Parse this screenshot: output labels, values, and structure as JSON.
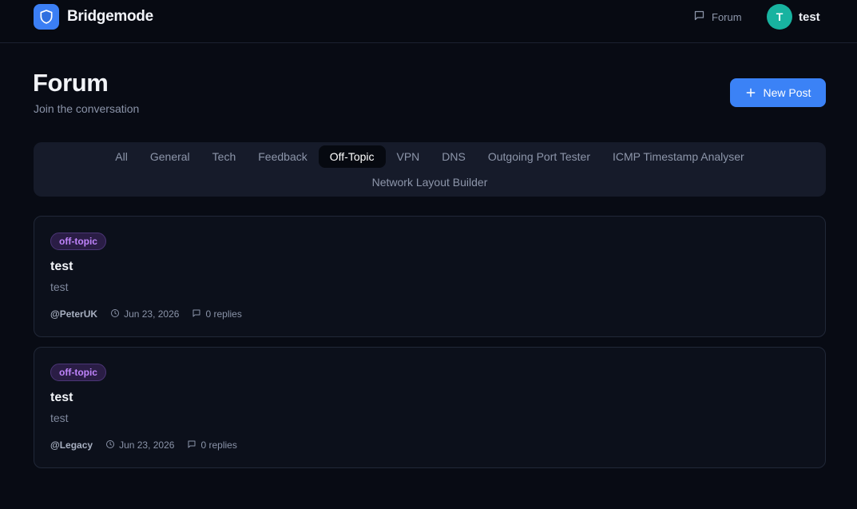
{
  "header": {
    "brand_name": "Bridgemode",
    "logo_icon": "shield-icon",
    "nav_forum_label": "Forum",
    "user_initial": "T",
    "user_name": "test"
  },
  "page": {
    "title": "Forum",
    "subtitle": "Join the conversation",
    "new_post_label": "New Post"
  },
  "tabs": [
    {
      "label": "All",
      "active": false
    },
    {
      "label": "General",
      "active": false
    },
    {
      "label": "Tech",
      "active": false
    },
    {
      "label": "Feedback",
      "active": false
    },
    {
      "label": "Off-Topic",
      "active": true
    },
    {
      "label": "VPN",
      "active": false
    },
    {
      "label": "DNS",
      "active": false
    },
    {
      "label": "Outgoing Port Tester",
      "active": false
    },
    {
      "label": "ICMP Timestamp Analyser",
      "active": false
    },
    {
      "label": "Network Layout Builder",
      "active": false
    }
  ],
  "posts": [
    {
      "tag": "off-topic",
      "title": "test",
      "body": "test",
      "author": "@PeterUK",
      "date": "Jun 23, 2026",
      "replies": "0 replies"
    },
    {
      "tag": "off-topic",
      "title": "test",
      "body": "test",
      "author": "@Legacy",
      "date": "Jun 23, 2026",
      "replies": "0 replies"
    }
  ],
  "colors": {
    "accent": "#3b82f6",
    "avatar": "#18b3a0",
    "tag_text": "#c084fc",
    "background": "#080b14"
  }
}
